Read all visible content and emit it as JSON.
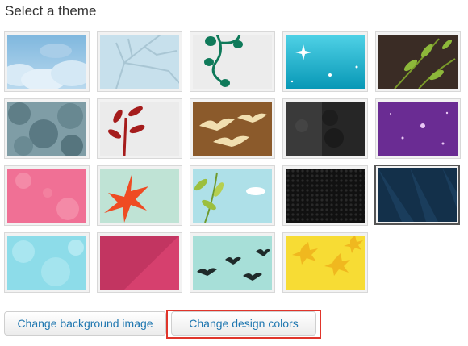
{
  "header": {
    "title": "Select a theme"
  },
  "buttons": {
    "change_background": "Change background image",
    "change_colors": "Change design colors"
  },
  "themes": [
    {
      "id": "clouds-blue",
      "selected": false
    },
    {
      "id": "bare-tree",
      "selected": false
    },
    {
      "id": "green-vine",
      "selected": false
    },
    {
      "id": "teal-sparkle",
      "selected": false
    },
    {
      "id": "leaf-branch-dark",
      "selected": false
    },
    {
      "id": "foliage-gray",
      "selected": false
    },
    {
      "id": "red-plant",
      "selected": false
    },
    {
      "id": "birds-brown",
      "selected": false
    },
    {
      "id": "dark-grunge",
      "selected": false
    },
    {
      "id": "purple-sparkle",
      "selected": false
    },
    {
      "id": "pink-flowers",
      "selected": false
    },
    {
      "id": "red-leaf",
      "selected": false
    },
    {
      "id": "leaves-cloud",
      "selected": false
    },
    {
      "id": "black-hex",
      "selected": false
    },
    {
      "id": "navy-rays",
      "selected": true
    },
    {
      "id": "bubbles-aqua",
      "selected": false
    },
    {
      "id": "raspberry-diagonal",
      "selected": false
    },
    {
      "id": "birds-aqua",
      "selected": false
    },
    {
      "id": "yellow-leaves",
      "selected": false
    }
  ],
  "colors": {
    "accent": "#1f77b0",
    "highlight": "#e0352b"
  }
}
